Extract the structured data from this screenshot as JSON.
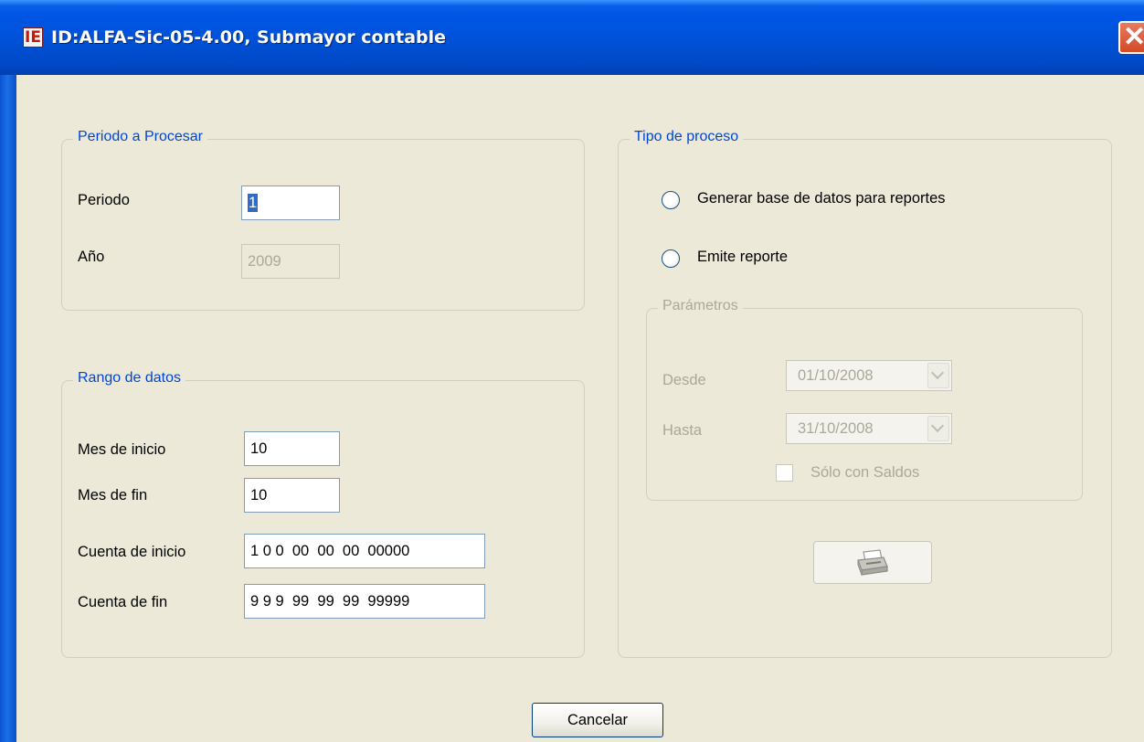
{
  "window": {
    "title": "ID:ALFA-Sic-05-4.00,  Submayor contable",
    "app_icon_glyph": "IE",
    "close_glyph": "✕",
    "title_bar_color": "#0054e3",
    "background_color": "#ece9d8"
  },
  "periodo": {
    "legend": "Periodo a Procesar",
    "periodo_label": "Periodo",
    "periodo_value": "1",
    "anio_label": "Año",
    "anio_value": "2009"
  },
  "rango": {
    "legend": "Rango de datos",
    "mes_inicio_label": "Mes de inicio",
    "mes_inicio_value": "10",
    "mes_fin_label": "Mes de fin",
    "mes_fin_value": "10",
    "cuenta_inicio_label": "Cuenta de inicio",
    "cuenta_inicio_value": "1 0 0  00  00  00  00000",
    "cuenta_fin_label": "Cuenta de fin",
    "cuenta_fin_value": "9 9 9  99  99  99  99999"
  },
  "tipo": {
    "legend": "Tipo de proceso",
    "option_generar": "Generar base de datos para reportes",
    "option_emite": "Emite reporte",
    "selected": null
  },
  "parametros": {
    "legend": "Parámetros",
    "desde_label": "Desde",
    "desde_value": "01/10/2008",
    "hasta_label": "Hasta",
    "hasta_value": "31/10/2008",
    "solo_saldos_label": "Sólo con Saldos",
    "solo_saldos_checked": false,
    "print_icon": "printer-icon"
  },
  "footer": {
    "cancel_label": "Cancelar"
  }
}
